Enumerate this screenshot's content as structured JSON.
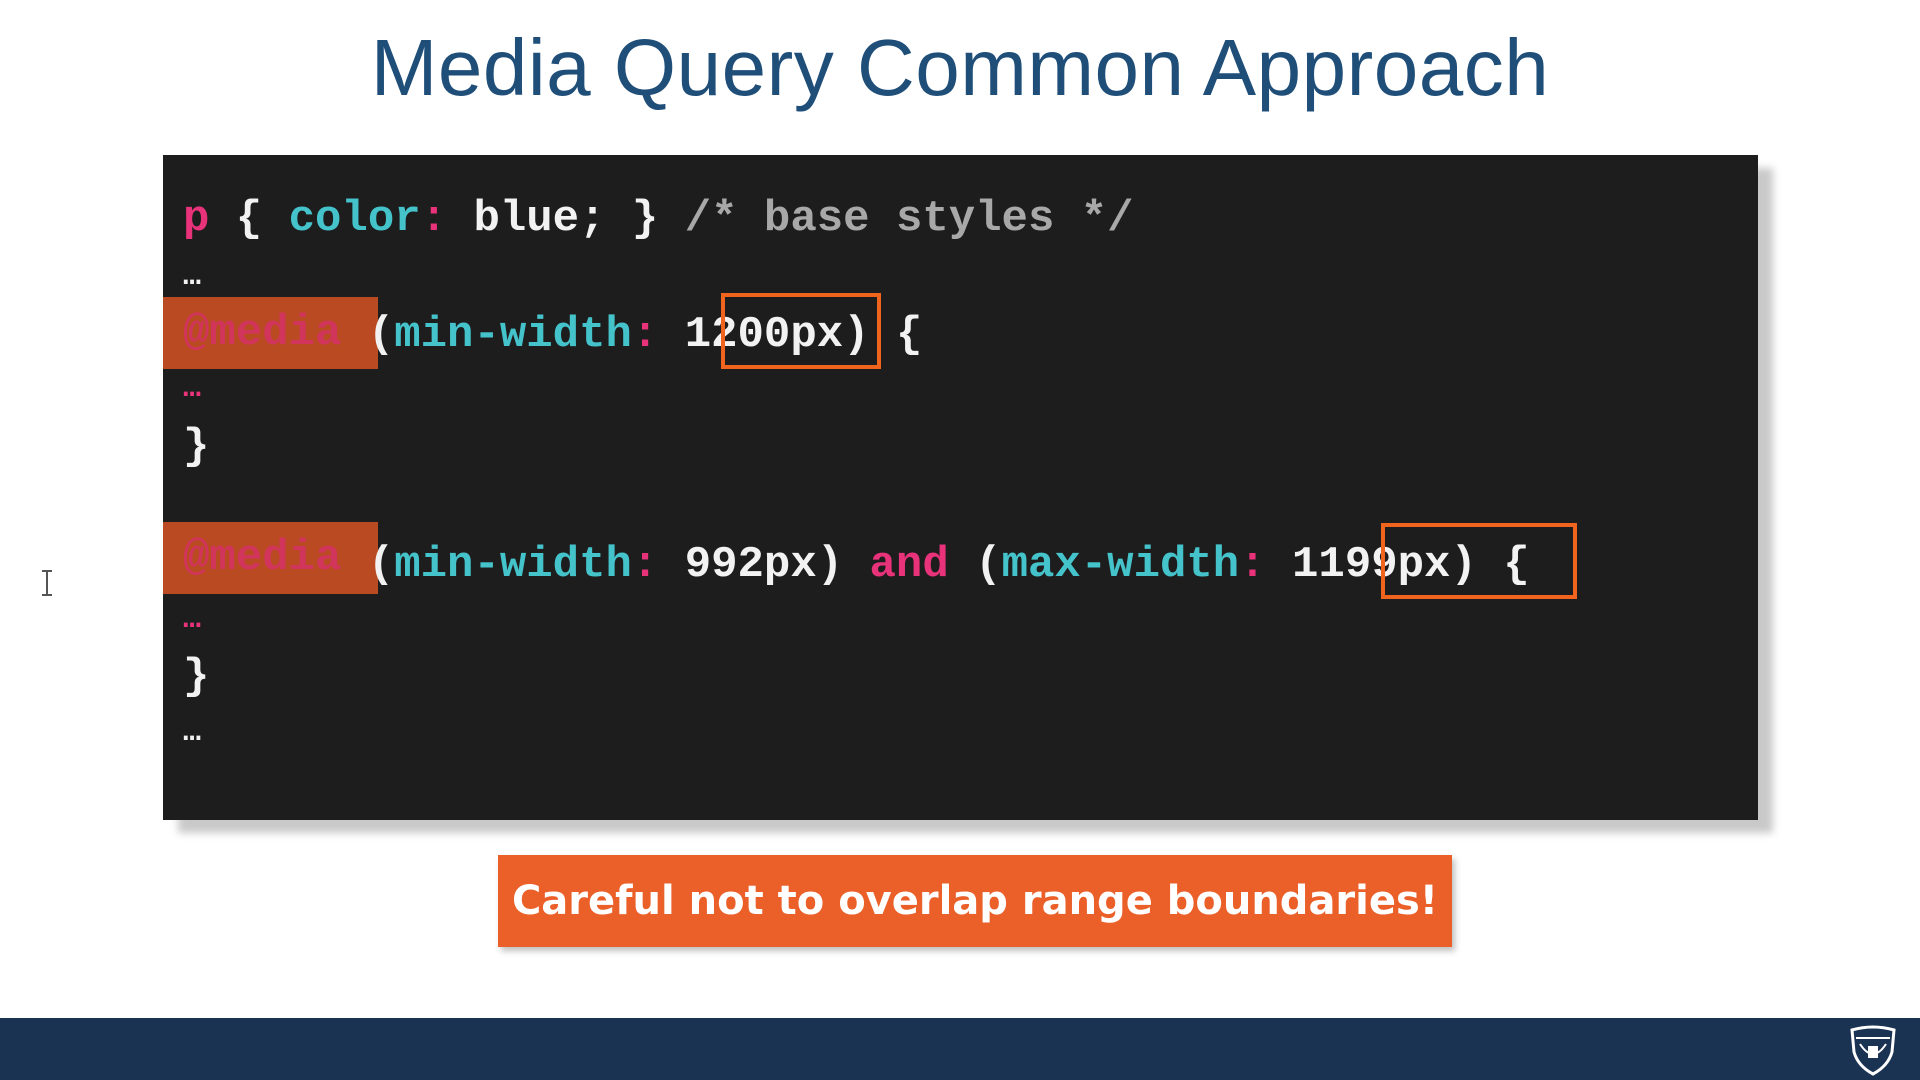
{
  "slide": {
    "title": "Media Query Common Approach"
  },
  "code": {
    "line1": {
      "selector": "p",
      "open_brace": " { ",
      "property": "color",
      "colon": ":",
      "value": " blue; } ",
      "comment": "/* base styles */"
    },
    "line2": {
      "ellipsis": "…"
    },
    "line3": {
      "at_rule": "@media",
      "open_paren": " (",
      "feature": "min-width",
      "colon": ":",
      "space": " ",
      "value": "1200px",
      "close": ") {"
    },
    "line4": {
      "ellipsis": "…"
    },
    "line5": {
      "close_brace": "}"
    },
    "line6": {
      "at_rule": "@media",
      "open_paren": " (",
      "feature1": "min-width",
      "colon1": ":",
      "value1": " 992px) ",
      "and": "and",
      "open_paren2": " (",
      "feature2": "max-width",
      "colon2": ":",
      "space": " ",
      "value2": "1199px",
      "close": ") {"
    },
    "line7": {
      "ellipsis": "…"
    },
    "line8": {
      "close_brace": "}"
    },
    "line9": {
      "ellipsis": "…"
    }
  },
  "banner": {
    "text": "Careful not to overlap range boundaries!"
  },
  "colors": {
    "title": "#1f4e79",
    "code_background": "#1d1d1d",
    "keyword_pink": "#e8327a",
    "property_cyan": "#45c3cb",
    "comment_gray": "#a8a8a8",
    "highlight_orange": "#f0641e",
    "banner_orange": "#eb5f28",
    "footer_navy": "#1b3353"
  },
  "icons": {
    "cursor": "text-cursor-icon",
    "logo": "university-shield-logo"
  }
}
